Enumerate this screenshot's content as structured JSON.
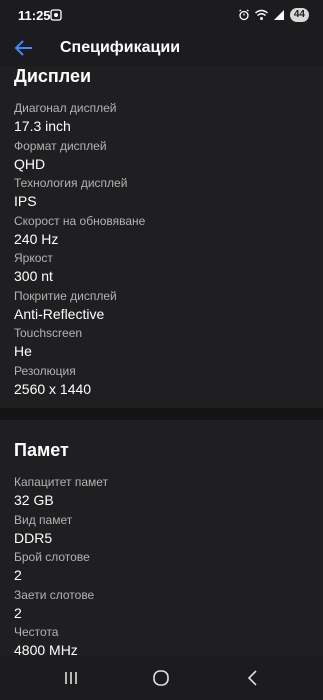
{
  "status": {
    "time": "11:25",
    "battery": "44"
  },
  "header": {
    "title": "Спецификации"
  },
  "sections": [
    {
      "title": "Дисплеи",
      "rows": [
        {
          "label": "Диагонал дисплей",
          "value": "17.3 inch"
        },
        {
          "label": "Формат дисплей",
          "value": "QHD"
        },
        {
          "label": "Технология дисплей",
          "value": "IPS"
        },
        {
          "label": "Скорост на обновяване",
          "value": "240 Hz"
        },
        {
          "label": "Яркост",
          "value": "300 nt"
        },
        {
          "label": "Покритие дисплей",
          "value": "Anti-Reflective"
        },
        {
          "label": "Touchscreen",
          "value": "Не"
        },
        {
          "label": "Резолюция",
          "value": "2560 x 1440"
        }
      ]
    },
    {
      "title": "Памет",
      "rows": [
        {
          "label": "Капацитет памет",
          "value": "32 GB"
        },
        {
          "label": "Вид памет",
          "value": "DDR5"
        },
        {
          "label": "Брой слотове",
          "value": "2"
        },
        {
          "label": "Заети слотове",
          "value": "2"
        },
        {
          "label": "Честота",
          "value": "4800 MHz"
        }
      ]
    }
  ],
  "icons": {
    "back": "arrow-left-icon",
    "nav_recents": "recents-icon",
    "nav_home": "home-icon",
    "nav_back": "back-chevron-icon"
  },
  "colors": {
    "accent": "#3d8bfd",
    "background": "#1c1c1e"
  }
}
